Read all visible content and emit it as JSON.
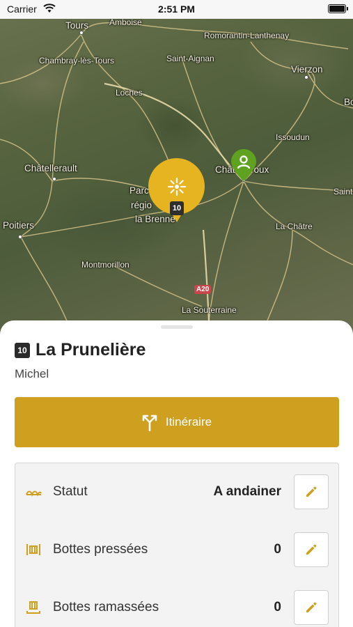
{
  "status_bar": {
    "carrier": "Carrier",
    "time": "2:51 PM"
  },
  "map": {
    "places": [
      {
        "name": "Tours"
      },
      {
        "name": "Amboise"
      },
      {
        "name": "Romorantin-Lanthenay"
      },
      {
        "name": "Chambray-lès-Tours"
      },
      {
        "name": "Saint-Aignan"
      },
      {
        "name": "Vierzon"
      },
      {
        "name": "Loches"
      },
      {
        "name": "Bo"
      },
      {
        "name": "Issoudun"
      },
      {
        "name": "Châtellerault"
      },
      {
        "name": "Châteauroux"
      },
      {
        "name": "Parc"
      },
      {
        "name": "régio"
      },
      {
        "name": "la Brenne"
      },
      {
        "name": "Saint"
      },
      {
        "name": "Poitiers"
      },
      {
        "name": "La Châtre"
      },
      {
        "name": "Montmorillon"
      },
      {
        "name": "La Souterraine"
      }
    ],
    "highway": "A20",
    "cluster_badge": "10",
    "cluster_icon": "sun-burst-icon",
    "user_icon": "person-pin-icon"
  },
  "sheet": {
    "badge": "10",
    "title": "La Prunelière",
    "owner": "Michel",
    "route_button": {
      "label": "Itinéraire",
      "icon": "fork-route-icon"
    },
    "rows": [
      {
        "label": "Statut",
        "value": "A andainer",
        "icon": "windrow-icon"
      },
      {
        "label": "Bottes pressées",
        "value": "0",
        "icon": "bale-icon"
      },
      {
        "label": "Bottes ramassées",
        "value": "0",
        "icon": "pickup-icon"
      }
    ]
  },
  "colors": {
    "accent": "#cfa020",
    "marker": "#e6b321",
    "user_pin": "#5ea21f"
  }
}
